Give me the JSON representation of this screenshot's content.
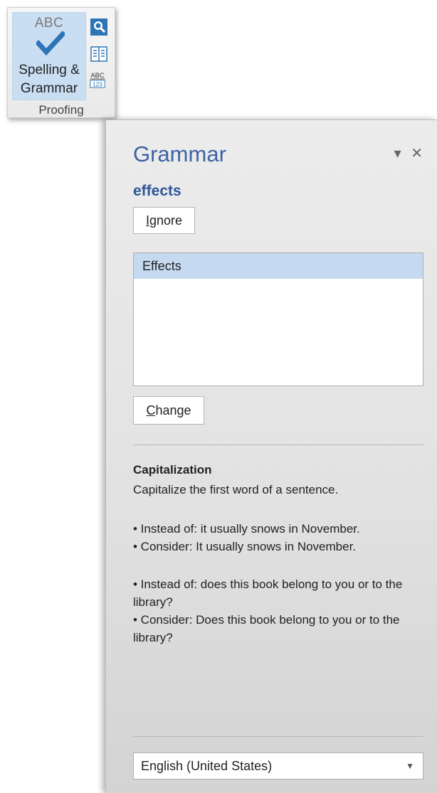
{
  "ribbon": {
    "spelling_button": {
      "abc_text": "ABC",
      "label_line1": "Spelling &",
      "label_line2": "Grammar"
    },
    "small_icons": [
      "research-icon",
      "thesaurus-icon",
      "word-count-icon"
    ],
    "word_count_icon_text": {
      "top": "ABC",
      "bottom": "123"
    },
    "group_label": "Proofing"
  },
  "pane": {
    "title": "Grammar",
    "controls": {
      "menu": "▾",
      "close": "✕"
    },
    "error_word": "effects",
    "ignore_button": {
      "accel": "I",
      "rest": "gnore"
    },
    "suggestions": [
      "Effects"
    ],
    "change_button": {
      "accel": "C",
      "rest": "hange"
    },
    "rule": {
      "title": "Capitalization",
      "description": "Capitalize the first word of a sentence.",
      "examples": [
        "• Instead of: it usually snows in November.",
        "• Consider: It usually snows in November.",
        "• Instead of: does this book belong to you or to the library?",
        "• Consider: Does this book belong to you or to the library?"
      ]
    },
    "language": "English (United States)"
  },
  "colors": {
    "title_blue": "#3c64a4",
    "selection": "#c5d9f1",
    "check_blue": "#2e75b6"
  }
}
